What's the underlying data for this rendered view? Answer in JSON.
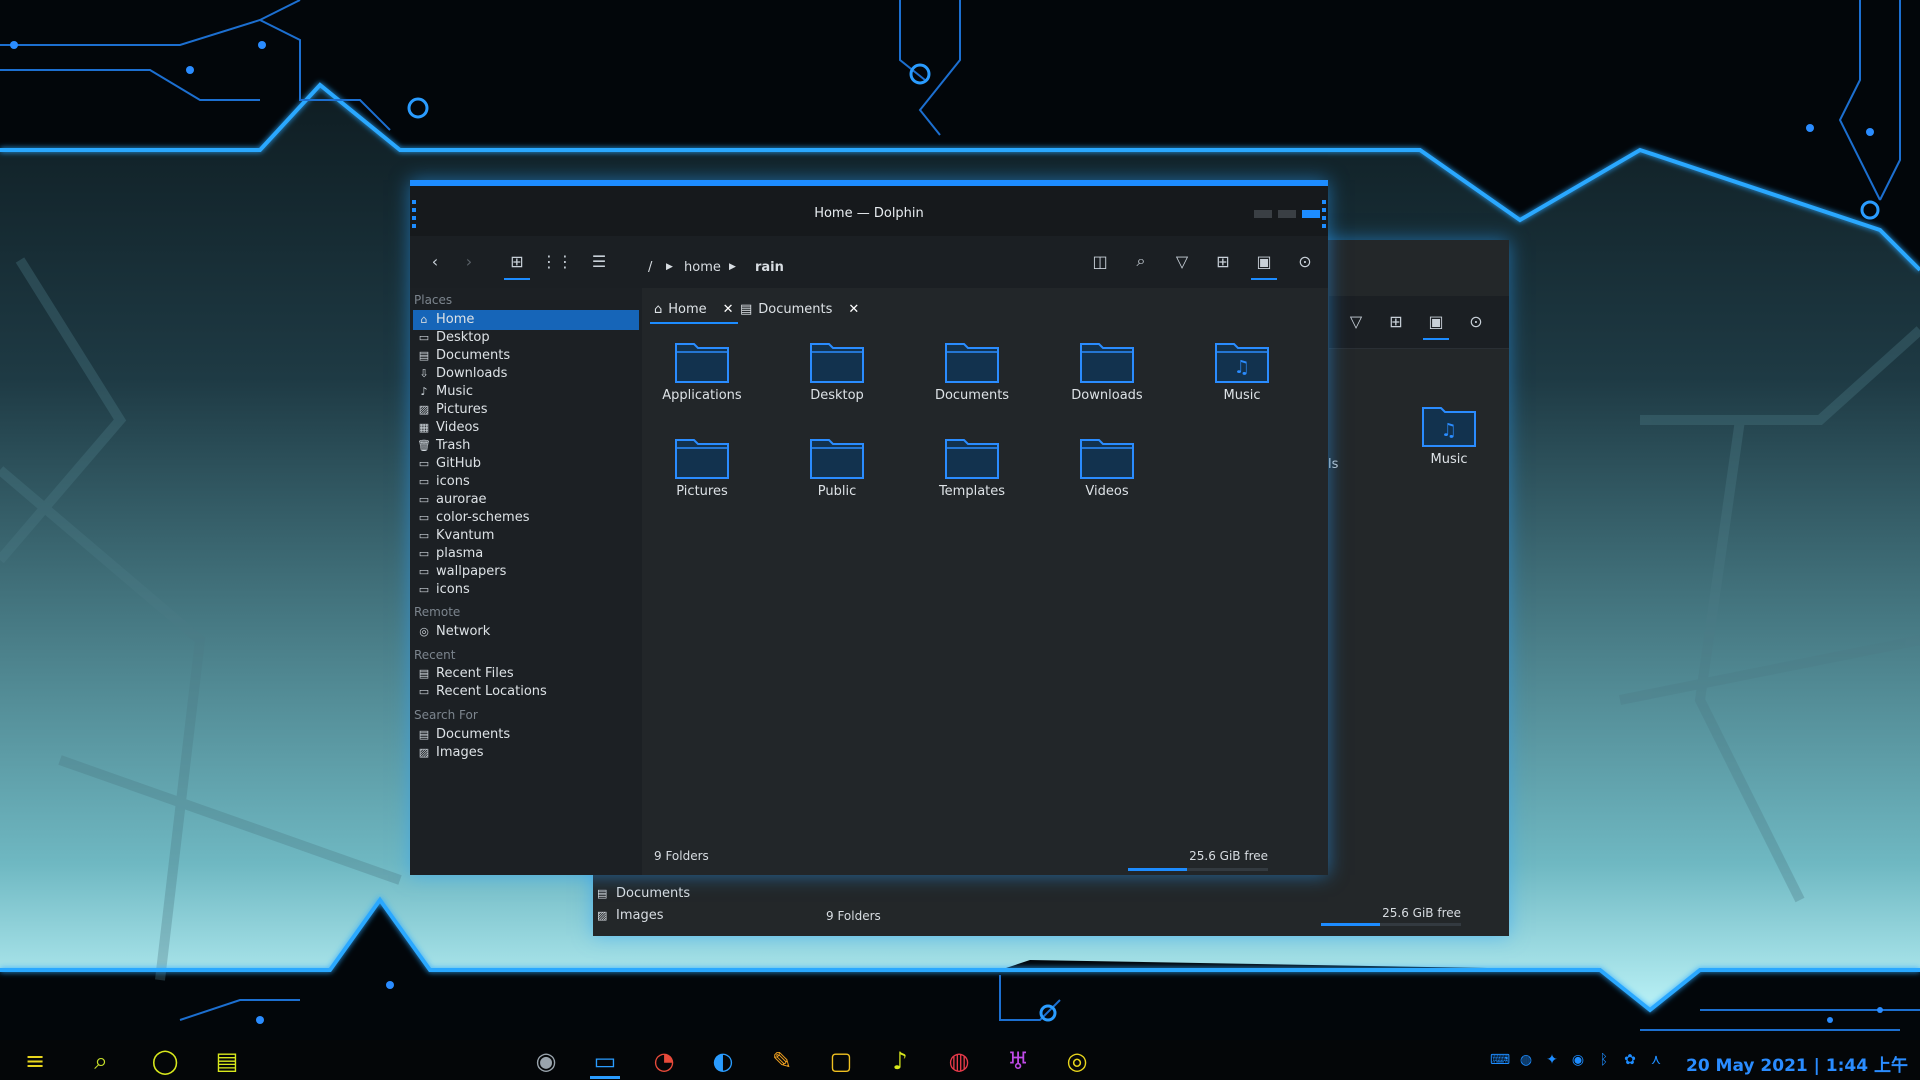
{
  "window": {
    "title": "Home — Dolphin",
    "breadcrumb": [
      "/",
      "home",
      "rain"
    ],
    "tabs": [
      {
        "label": "Home",
        "icon": "home-icon"
      },
      {
        "label": "Documents",
        "icon": "document-icon"
      }
    ],
    "places": {
      "places_title": "Places",
      "items": [
        {
          "label": "Home",
          "icon": "home-icon"
        },
        {
          "label": "Desktop",
          "icon": "desktop-icon"
        },
        {
          "label": "Documents",
          "icon": "document-icon"
        },
        {
          "label": "Downloads",
          "icon": "download-icon"
        },
        {
          "label": "Music",
          "icon": "music-icon"
        },
        {
          "label": "Pictures",
          "icon": "picture-icon"
        },
        {
          "label": "Videos",
          "icon": "video-icon"
        },
        {
          "label": "Trash",
          "icon": "trash-icon"
        },
        {
          "label": "GitHub",
          "icon": "folder-icon"
        },
        {
          "label": "icons",
          "icon": "folder-icon"
        },
        {
          "label": "aurorae",
          "icon": "folder-icon"
        },
        {
          "label": "color-schemes",
          "icon": "folder-icon"
        },
        {
          "label": "Kvantum",
          "icon": "folder-icon"
        },
        {
          "label": "plasma",
          "icon": "folder-icon"
        },
        {
          "label": "wallpapers",
          "icon": "folder-icon"
        },
        {
          "label": "icons",
          "icon": "folder-icon"
        }
      ],
      "remote_title": "Remote",
      "remote_items": [
        {
          "label": "Network",
          "icon": "network-icon"
        }
      ],
      "recent_title": "Recent",
      "recent_items": [
        {
          "label": "Recent Files",
          "icon": "recent-files-icon"
        },
        {
          "label": "Recent Locations",
          "icon": "recent-locations-icon"
        }
      ],
      "search_title": "Search For",
      "search_items": [
        {
          "label": "Documents",
          "icon": "document-icon"
        },
        {
          "label": "Images",
          "icon": "picture-icon"
        }
      ]
    },
    "folders": [
      {
        "label": "Applications",
        "glyph": ""
      },
      {
        "label": "Desktop",
        "glyph": ""
      },
      {
        "label": "Documents",
        "glyph": ""
      },
      {
        "label": "Downloads",
        "glyph": ""
      },
      {
        "label": "Music",
        "glyph": "♫"
      },
      {
        "label": "Pictures",
        "glyph": ""
      },
      {
        "label": "Public",
        "glyph": ""
      },
      {
        "label": "Templates",
        "glyph": ""
      },
      {
        "label": "Videos",
        "glyph": ""
      }
    ],
    "status_left": "9 Folders",
    "status_right": "25.6 GiB free",
    "free_space_used_fraction": 0.42
  },
  "back_window": {
    "folder_label": "Music",
    "partial_label": "ls",
    "search_items": [
      "Documents",
      "Images"
    ],
    "status_left": "9 Folders",
    "status_right": "25.6 GiB free"
  },
  "taskbar": {
    "clock": "20 May 2021 | 1:44 上午",
    "launchers": [
      "app-menu-icon",
      "search-icon",
      "circle-icon",
      "window-overview-icon"
    ],
    "tasks": [
      "screenshot-app-icon",
      "dolphin-icon",
      "firefox-icon",
      "edge-icon",
      "krita-icon",
      "store-icon",
      "spotify-icon",
      "music-app-icon",
      "git-app-icon",
      "chat-app-icon"
    ],
    "tray": [
      "keyboard-icon",
      "notification-icon",
      "network-sensor-icon",
      "clipboard-icon",
      "bluetooth-icon",
      "settings-icon",
      "arrow-up-icon"
    ]
  },
  "colors": {
    "accent": "#1d8cff",
    "window_bg": "#1e2226",
    "taskbar_bg": "#040608"
  }
}
